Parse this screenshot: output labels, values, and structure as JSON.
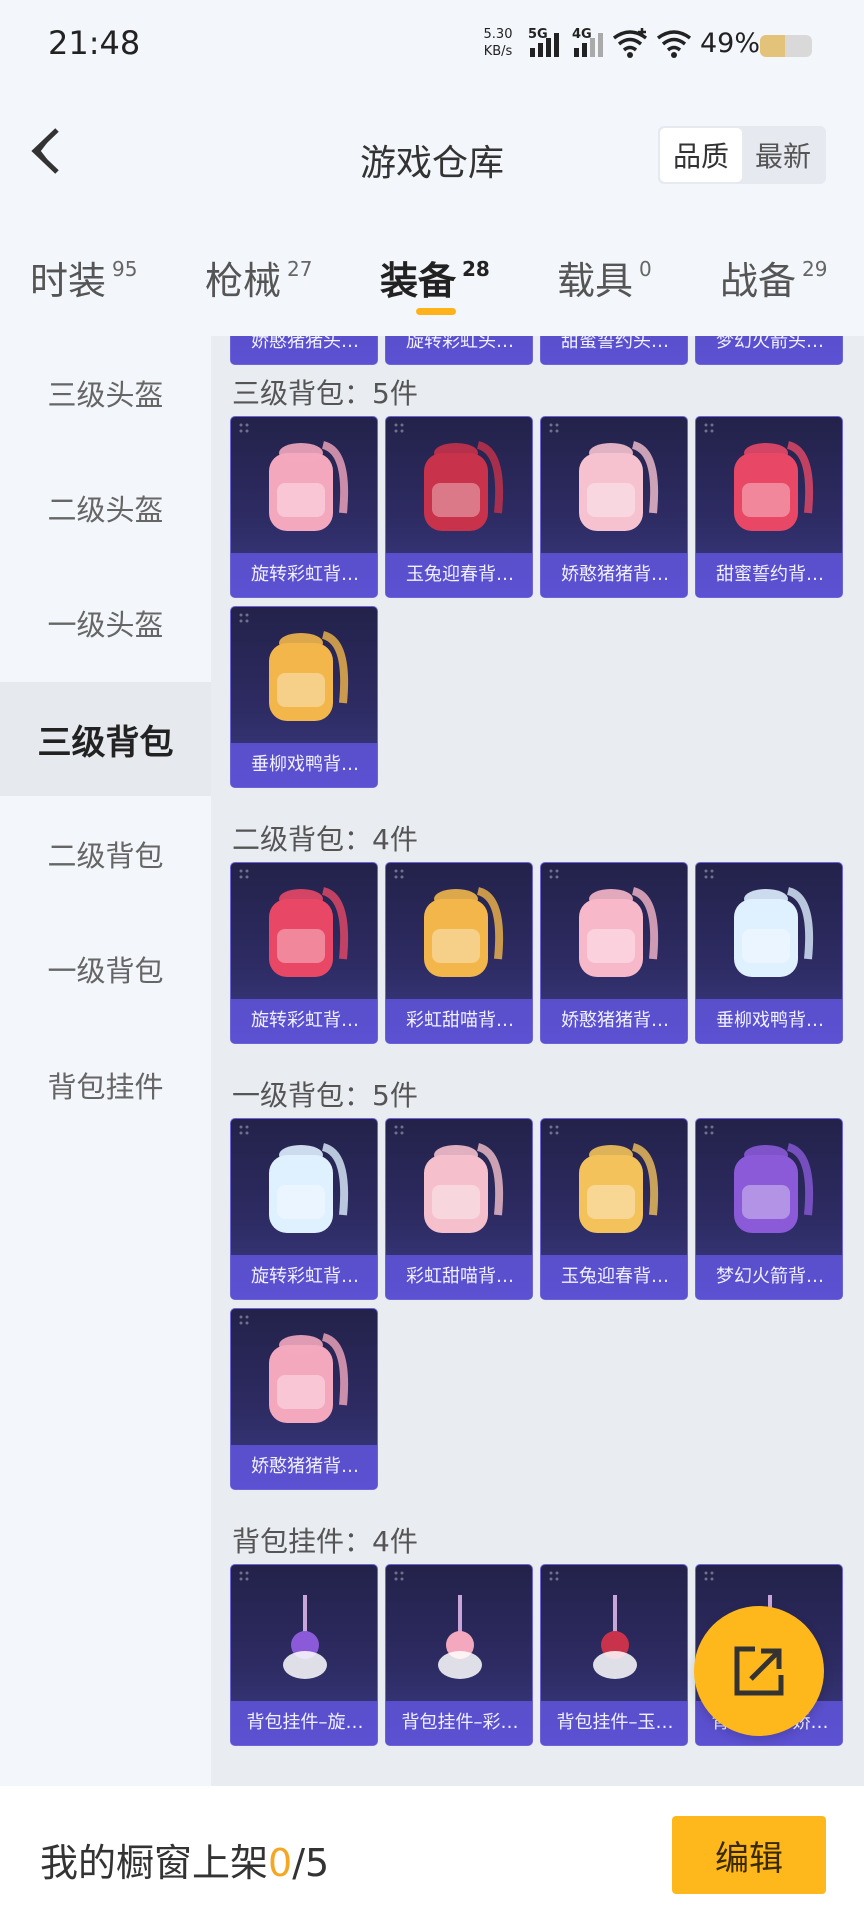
{
  "status_bar": {
    "time": "21:48",
    "speed_value": "5.30",
    "speed_unit": "KB/s",
    "net1": "5G",
    "net2": "4G",
    "battery_percent": "49%",
    "battery_level": 0.49
  },
  "header": {
    "title": "游戏仓库",
    "sort_options": [
      "品质",
      "最新"
    ],
    "active_sort": "品质"
  },
  "category_tabs": [
    {
      "label": "时装",
      "count": "95"
    },
    {
      "label": "枪械",
      "count": "27"
    },
    {
      "label": "装备",
      "count": "28",
      "active": true
    },
    {
      "label": "载具",
      "count": "0"
    },
    {
      "label": "战备",
      "count": "29"
    }
  ],
  "sidebar": {
    "items": [
      "三级头盔",
      "二级头盔",
      "一级头盔",
      "三级背包",
      "二级背包",
      "一级背包",
      "背包挂件"
    ],
    "active": "三级背包"
  },
  "content": {
    "top_row": [
      "娇憨猪猪头…",
      "旋转彩虹头…",
      "甜蜜誓约头…",
      "梦幻火箭头…"
    ],
    "sections": [
      {
        "title": "三级背包：5件",
        "items": [
          "旋转彩虹背…",
          "玉兔迎春背…",
          "娇憨猪猪背…",
          "甜蜜誓约背…",
          "垂柳戏鸭背…"
        ]
      },
      {
        "title": "二级背包：4件",
        "items": [
          "旋转彩虹背…",
          "彩虹甜喵背…",
          "娇憨猪猪背…",
          "垂柳戏鸭背…"
        ]
      },
      {
        "title": "一级背包：5件",
        "items": [
          "旋转彩虹背…",
          "彩虹甜喵背…",
          "玉兔迎春背…",
          "梦幻火箭背…",
          "娇憨猪猪背…"
        ]
      },
      {
        "title": "背包挂件：4件",
        "items": [
          "背包挂件–旋…",
          "背包挂件–彩…",
          "背包挂件–玉…",
          "背包挂件–娇…"
        ]
      }
    ]
  },
  "bottom_bar": {
    "label": "我的橱窗上架",
    "current": "0",
    "separator": "/",
    "max": "5",
    "edit_label": "编辑"
  },
  "fab": {
    "icon": "share-icon"
  },
  "colors": {
    "accent": "#ffb81c",
    "card_bg": "#2d2b62",
    "card_label_bg": "#5a4fcb",
    "page_bg": "#f3f6fa"
  }
}
